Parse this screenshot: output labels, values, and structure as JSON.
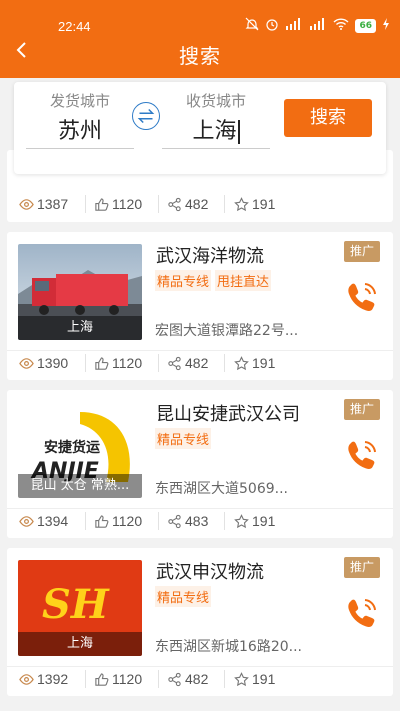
{
  "status_bar": {
    "time": "22:44",
    "battery": "66"
  },
  "header": {
    "title": "搜索"
  },
  "search": {
    "from_label": "发货城市",
    "from_value": "苏州",
    "to_label": "收货城市",
    "to_value": "上海",
    "button_label": "搜索"
  },
  "partial_card": {
    "stats": {
      "views": "1387",
      "likes": "1120",
      "shares": "482",
      "stars": "191"
    }
  },
  "cards": [
    {
      "name": "武汉海洋物流",
      "tags": [
        "精品专线",
        "甩挂直达"
      ],
      "address": "宏图大道银潭路22号...",
      "thumb_label": "上海",
      "promo": "推广",
      "stats": {
        "views": "1390",
        "likes": "1120",
        "shares": "482",
        "stars": "191"
      }
    },
    {
      "name": "昆山安捷武汉公司",
      "tags": [
        "精品专线"
      ],
      "address": "东西湖区大道5069...",
      "thumb_label": "昆山 太仓 常熟...",
      "thumb_logo_text": "安捷货运",
      "thumb_logo_brand": "ANJIE",
      "promo": "推广",
      "stats": {
        "views": "1394",
        "likes": "1120",
        "shares": "483",
        "stars": "191"
      }
    },
    {
      "name": "武汉申汉物流",
      "tags": [
        "精品专线"
      ],
      "address": "东西湖区新城16路20...",
      "thumb_label": "上海",
      "thumb_logo_brand": "SH",
      "promo": "推广",
      "stats": {
        "views": "1392",
        "likes": "1120",
        "shares": "482",
        "stars": "191"
      }
    }
  ],
  "colors": {
    "accent": "#f26d12",
    "promo": "#c89a63",
    "swap": "#2e7bc7"
  }
}
